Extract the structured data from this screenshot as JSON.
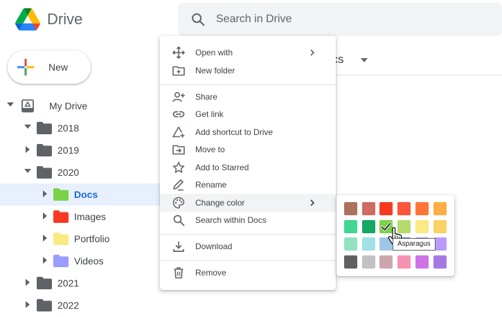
{
  "app": {
    "brand": "Drive"
  },
  "search": {
    "placeholder": "Search in Drive"
  },
  "new_button": {
    "label": "New"
  },
  "tree": [
    {
      "label": "My Drive",
      "caret": "down",
      "level": 0,
      "type": "drive"
    },
    {
      "label": "2018",
      "caret": "down",
      "level": 1,
      "folder_color": "#5f6368"
    },
    {
      "label": "2019",
      "caret": "right",
      "level": 1,
      "folder_color": "#5f6368"
    },
    {
      "label": "2020",
      "caret": "down",
      "level": 1,
      "folder_color": "#5f6368"
    },
    {
      "label": "Docs",
      "caret": "right",
      "level": 2,
      "folder_color": "#7bd148",
      "selected": true
    },
    {
      "label": "Images",
      "caret": "right",
      "level": 2,
      "folder_color": "#f83a22"
    },
    {
      "label": "Portfolio",
      "caret": "right",
      "level": 2,
      "folder_color": "#fbe983"
    },
    {
      "label": "Videos",
      "caret": "right",
      "level": 2,
      "folder_color": "#9a9cff"
    },
    {
      "label": "2021",
      "caret": "right",
      "level": 1,
      "folder_color": "#5f6368"
    },
    {
      "label": "2022",
      "caret": "right",
      "level": 1,
      "folder_color": "#5f6368"
    }
  ],
  "main": {
    "title_fragment": "ocs"
  },
  "context_menu": {
    "items": [
      {
        "label": "Open with",
        "icon": "open-with-icon",
        "submenu": true
      },
      {
        "label": "New folder",
        "icon": "new-folder-icon"
      },
      {
        "separator": true
      },
      {
        "label": "Share",
        "icon": "share-person-icon"
      },
      {
        "label": "Get link",
        "icon": "link-icon"
      },
      {
        "label": "Add shortcut to Drive",
        "icon": "add-shortcut-icon"
      },
      {
        "label": "Move to",
        "icon": "move-to-icon"
      },
      {
        "label": "Add to Starred",
        "icon": "star-icon"
      },
      {
        "label": "Rename",
        "icon": "rename-pencil-icon"
      },
      {
        "label": "Change color",
        "icon": "palette-icon",
        "submenu": true,
        "hover": true
      },
      {
        "label": "Search within Docs",
        "icon": "search-icon"
      },
      {
        "separator": true
      },
      {
        "label": "Download",
        "icon": "download-icon"
      },
      {
        "separator": true
      },
      {
        "label": "Remove",
        "icon": "trash-icon"
      }
    ]
  },
  "color_palette": {
    "selected_index": 8,
    "tooltip": "Asparagus",
    "colors": [
      "#ac725e",
      "#d06b64",
      "#f83a22",
      "#fa573c",
      "#ff7537",
      "#ffad46",
      "#42d692",
      "#16a765",
      "#7bd148",
      "#b3dc6c",
      "#fbe983",
      "#fad165",
      "#92e1c0",
      "#9fe1e7",
      "#9fc6e7",
      "#4986e7",
      "#9a9cff",
      "#b99aff",
      "#616161",
      "#c2c2c2",
      "#cca6ac",
      "#f691b2",
      "#cd74e6",
      "#a47ae2"
    ]
  }
}
